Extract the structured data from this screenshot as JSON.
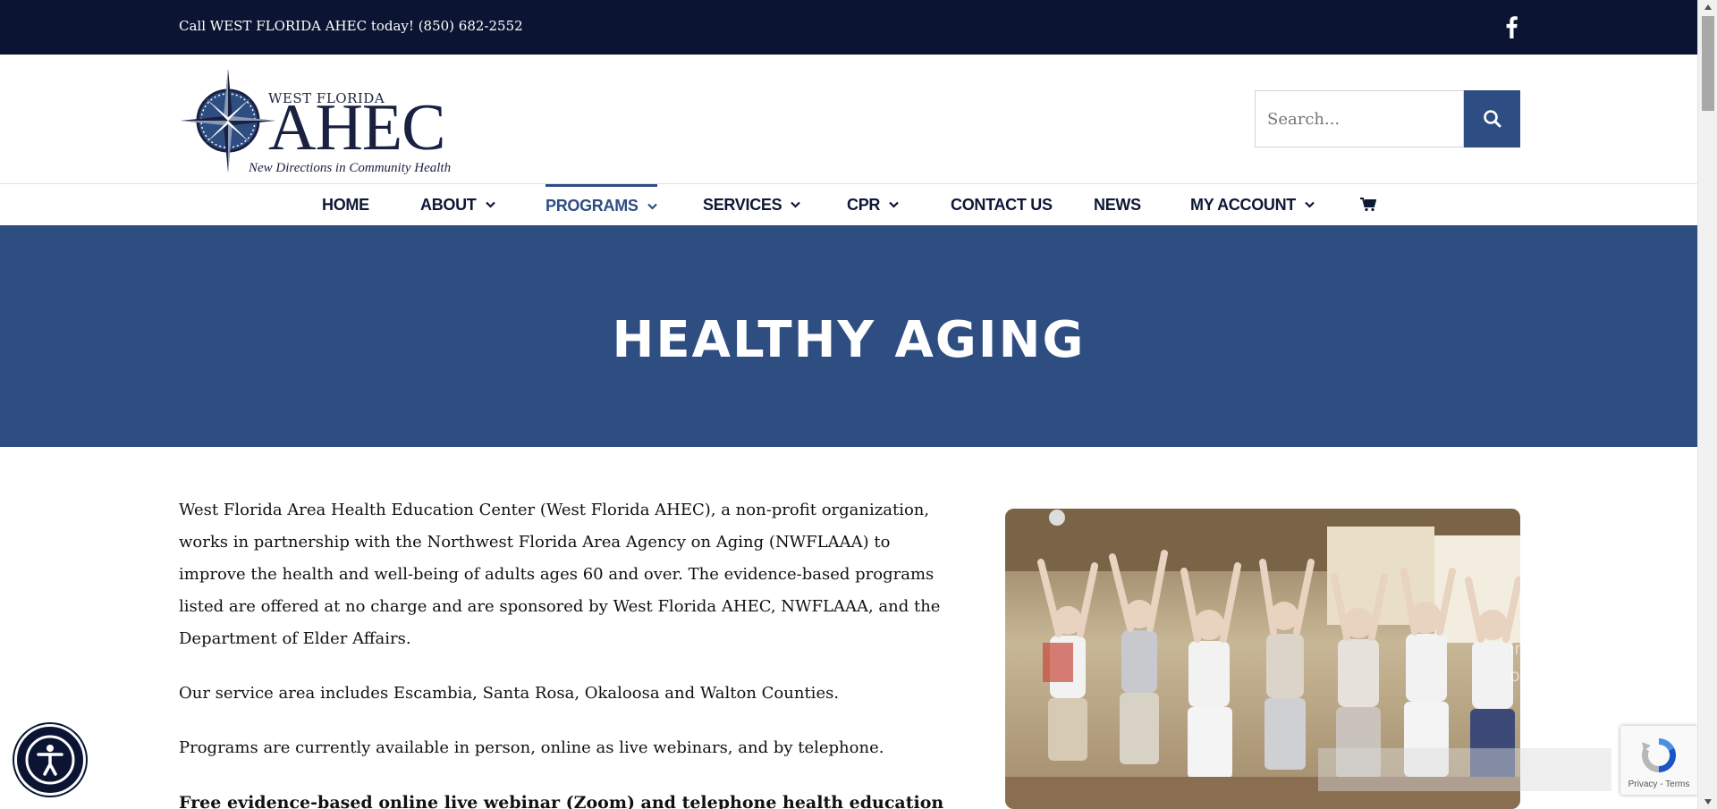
{
  "topbar": {
    "call_text": "Call WEST FLORIDA AHEC today! (850) 682-2552",
    "social_icon": "facebook-icon"
  },
  "logo": {
    "top_text": "WEST FLORIDA",
    "main_text": "AHEC",
    "tagline": "New Directions in Community Health"
  },
  "search": {
    "placeholder": "Search...",
    "icon": "search-icon"
  },
  "nav": {
    "items": [
      {
        "label": "HOME",
        "has_dropdown": false
      },
      {
        "label": "ABOUT",
        "has_dropdown": true
      },
      {
        "label": "PROGRAMS",
        "has_dropdown": true,
        "active": true
      },
      {
        "label": "SERVICES",
        "has_dropdown": true
      },
      {
        "label": "CPR",
        "has_dropdown": true
      },
      {
        "label": "CONTACT US",
        "has_dropdown": false
      },
      {
        "label": "NEWS",
        "has_dropdown": false
      },
      {
        "label": "MY ACCOUNT",
        "has_dropdown": true
      }
    ],
    "cart_icon": "shopping-cart-icon"
  },
  "hero": {
    "title": "HEALTHY AGING"
  },
  "content": {
    "paragraphs": [
      "West Florida Area Health Education Center (West Florida AHEC), a non-profit organization, works in partnership with the Northwest Florida Area Agency on Aging (NWFLAAA) to improve the health and well-being of adults ages 60 and over. The evidence-based programs listed are offered at no charge and are sponsored by West Florida AHEC, NWFLAAA, and the Department of Elder Affairs.",
      "Our service area includes Escambia, Santa Rosa, Okaloosa and Walton Counties.",
      "Programs are currently available in person, online as live webinars, and by telephone."
    ],
    "bold_heading": "Free evidence-based online live webinar (Zoom) and telephone health education"
  },
  "photo": {
    "icon": "seniors-exercise-photo"
  },
  "cookie_banner": {
    "text_line_1": "...ing our",
    "text_line_2": "...of cookies."
  },
  "recaptcha": {
    "links": "Privacy - Terms"
  },
  "colors": {
    "topbar": "#0b1533",
    "brand_blue": "#2e4e82",
    "nav_text": "#0d1736"
  }
}
